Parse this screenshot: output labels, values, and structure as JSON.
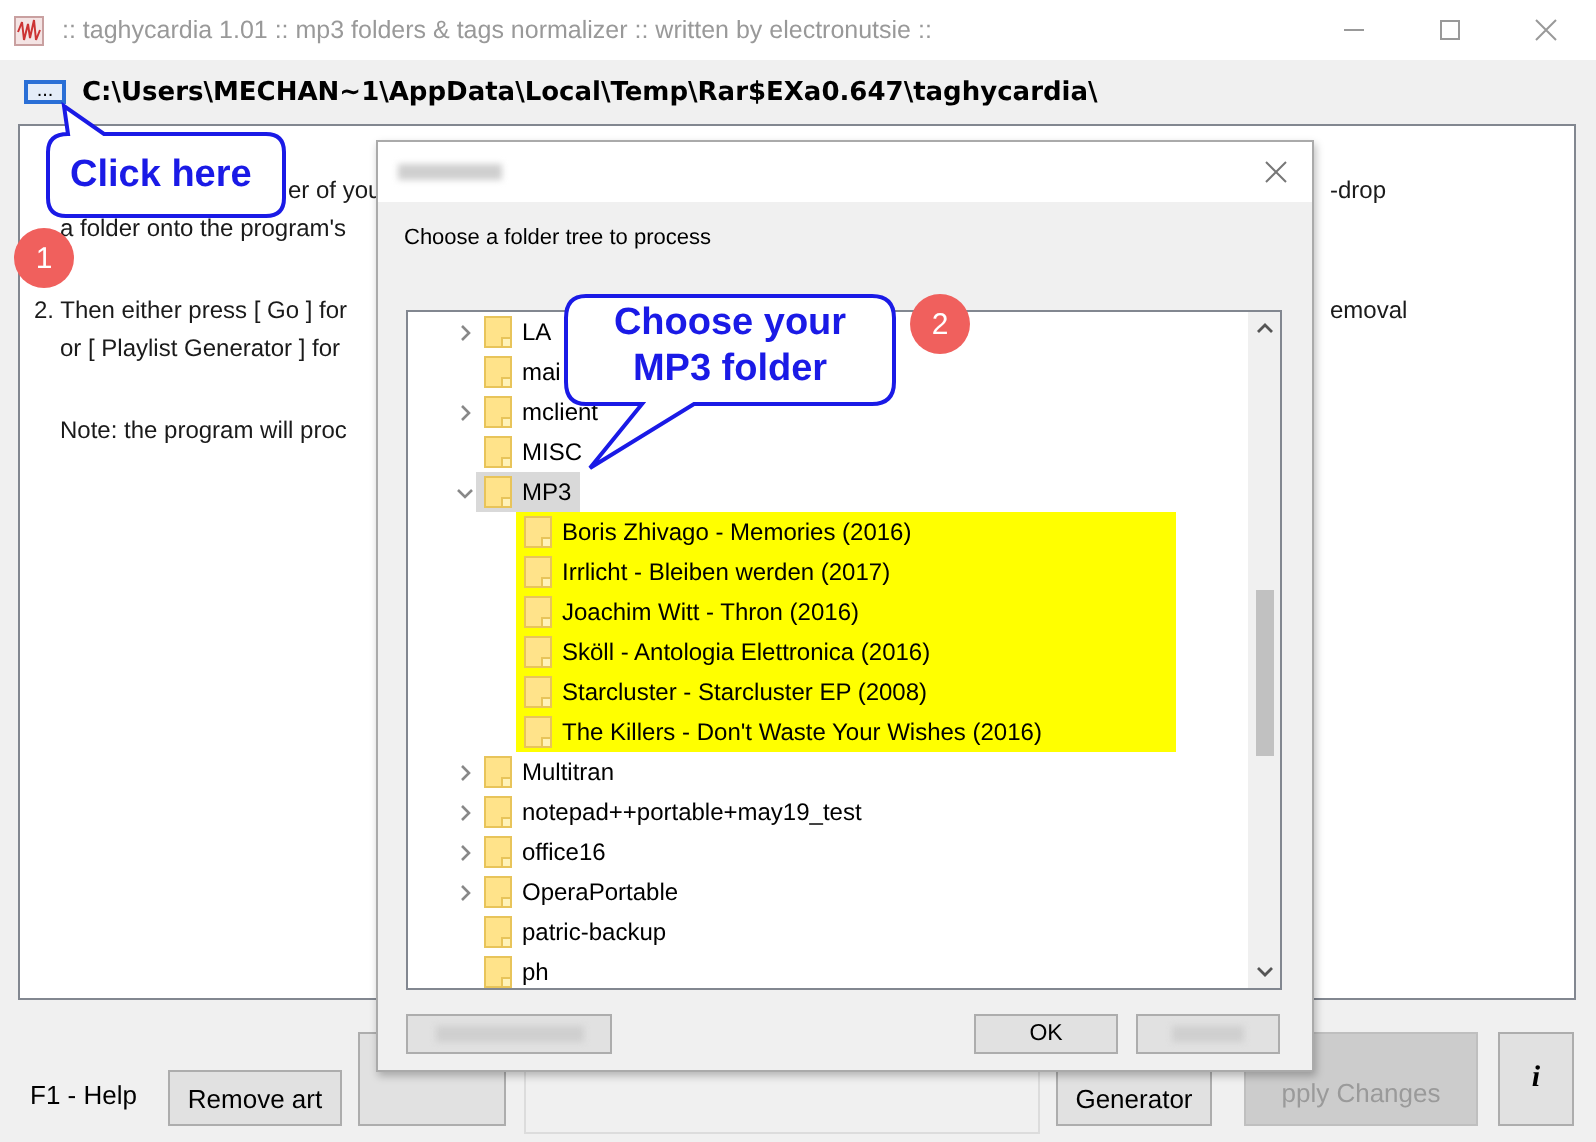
{
  "window": {
    "title": ":: taghycardia 1.01 :: mp3 folders & tags normalizer :: written by electronutsie ::"
  },
  "path_bar": {
    "browse_button": "...",
    "path": "C:\\Users\\MECHAN~1\\AppData\\Local\\Temp\\Rar$EXa0.647\\taghycardia\\"
  },
  "instructions": [
    {
      "kind": "covered",
      "left": "er of you",
      "right": "-drop",
      "gap_before": false
    },
    {
      "kind": "continued",
      "left": "a folder onto the program's",
      "gap_before": false
    },
    {
      "kind": "numbered",
      "left": "2. Then either press [ Go ] for",
      "right": "emoval",
      "gap_before": true
    },
    {
      "kind": "continued",
      "left": "or [ Playlist Generator ] for",
      "gap_before": false
    },
    {
      "kind": "continued",
      "left": "Note: the program will proc",
      "gap_before": true
    }
  ],
  "bottom_bar": {
    "help": "F1 - Help",
    "remove_art_button": "Remove art",
    "generator_button": "Generator",
    "apply_button": {
      "label": "pply Changes",
      "disabled": true
    },
    "info_button": "i"
  },
  "dialog": {
    "prompt": "Choose a folder tree to process",
    "ok_button": "OK",
    "tree": [
      {
        "label": "LA",
        "expanded": false,
        "selected": false
      },
      {
        "label": "mai",
        "selected": false
      },
      {
        "label": "mclient",
        "expanded": false,
        "selected": false
      },
      {
        "label": "MISC",
        "selected": false
      },
      {
        "label": "MP3",
        "expanded": true,
        "selected": true,
        "children": [
          {
            "label": "Boris Zhivago - Memories (2016)",
            "selected": false,
            "highlighted": true
          },
          {
            "label": "Irrlicht - Bleiben werden (2017)",
            "selected": false,
            "highlighted": true
          },
          {
            "label": "Joachim Witt - Thron (2016)",
            "selected": false,
            "highlighted": true
          },
          {
            "label": "Sköll - Antologia Elettronica (2016)",
            "selected": false,
            "highlighted": true
          },
          {
            "label": "Starcluster - Starcluster EP (2008)",
            "selected": false,
            "highlighted": true
          },
          {
            "label": "The Killers - Don't Waste Your Wishes (2016)",
            "selected": false,
            "highlighted": true
          }
        ]
      },
      {
        "label": "Multitran",
        "expanded": false,
        "selected": false
      },
      {
        "label": "notepad++portable+may19_test",
        "expanded": false,
        "selected": false
      },
      {
        "label": "office16",
        "expanded": false,
        "selected": false
      },
      {
        "label": "OperaPortable",
        "expanded": false,
        "selected": false
      },
      {
        "label": "patric-backup",
        "selected": false
      },
      {
        "label": "ph",
        "selected": false
      }
    ]
  },
  "callouts": [
    {
      "text": "Click here"
    },
    {
      "text": "Choose your MP3 folder"
    }
  ],
  "step_badges": [
    "1",
    "2"
  ]
}
